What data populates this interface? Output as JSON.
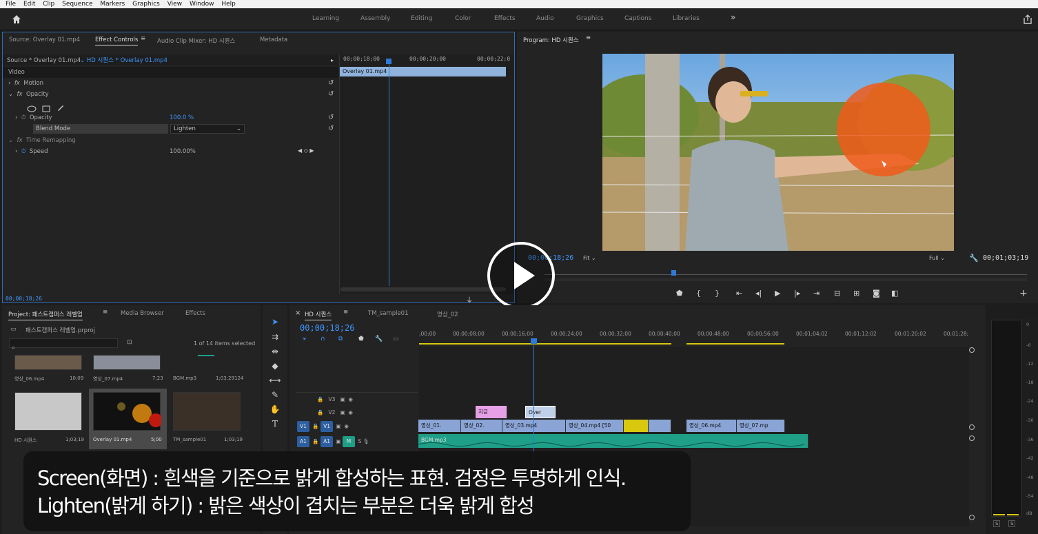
{
  "menu": [
    "File",
    "Edit",
    "Clip",
    "Sequence",
    "Markers",
    "Graphics",
    "View",
    "Window",
    "Help"
  ],
  "workspaces": [
    "Learning",
    "Assembly",
    "Editing",
    "Color",
    "Effects",
    "Audio",
    "Graphics",
    "Captions",
    "Libraries"
  ],
  "workspaces_more": "»",
  "effect_panel": {
    "tabs": [
      "Source: Overlay 01.mp4",
      "Effect Controls",
      "Audio Clip Mixer: HD 시퀀스",
      "Metadata"
    ],
    "source_label": "Source * Overlay 01.mp4",
    "sequence_label": "HD 시퀀스 * Overlay 01.mp4",
    "video_header": "Video",
    "motion": "Motion",
    "opacity": "Opacity",
    "opacity_prop": "Opacity",
    "opacity_value": "100.0 %",
    "blend_mode": "Blend Mode",
    "blend_value": "Lighten",
    "time_remapping": "Time Remapping",
    "speed": "Speed",
    "speed_value": "100.00%",
    "ruler": [
      "00;00;18;00",
      "00;00;20;00",
      "00;00;22;0"
    ],
    "clip_name": "Overlay 01.mp4",
    "timecode": "00;00;18;26"
  },
  "program": {
    "title": "Program: HD 시퀀스",
    "timecode": "00;00;18;26",
    "fit": "Fit",
    "quality": "Full",
    "duration": "00;01;03;19"
  },
  "project": {
    "tabs": [
      "Project: 패스트캠퍼스 레벨업",
      "Media Browser",
      "Effects"
    ],
    "file": "패스트캠퍼스 레벨업.prproj",
    "selected": "1 of 14 items selected",
    "items": [
      {
        "name": "영상_06.mp4",
        "dur": "10;09"
      },
      {
        "name": "영상_07.mp4",
        "dur": "7;23"
      },
      {
        "name": "BGM.mp3",
        "dur": "1;03;29124"
      },
      {
        "name": "HD 시퀀스",
        "dur": "1;03;19"
      },
      {
        "name": "Overlay 01.mp4",
        "dur": "5;00"
      },
      {
        "name": "TM_sample01",
        "dur": "1;03;19"
      }
    ]
  },
  "timeline": {
    "tabs": [
      "HD 시퀀스",
      "TM_sample01",
      "영상_02"
    ],
    "timecode": "00;00;18;26",
    "ruler": [
      ";00;00",
      "00;00;08;00",
      "00;00;16;00",
      "00;00;24;00",
      "00;00;32;00",
      "00;00;40;00",
      "00;00;48;00",
      "00;00;56;00",
      "00;01;04;02",
      "00;01;12;02",
      "00;01;20;02",
      "00;01;28;"
    ],
    "tracks": [
      "V3",
      "V2",
      "V1",
      "A1"
    ],
    "v2_clips": [
      "지금",
      "Over"
    ],
    "v1_clips": [
      "영상_01.",
      "영상_02.",
      "영상_03.mp4",
      "영상_04.mp4 [50",
      "영상_06.mp4",
      "영상_07.mp"
    ],
    "a1_clip": "BGM.mp3",
    "mute": "M",
    "solo": "S"
  },
  "meter": {
    "scale": [
      "0",
      "-6",
      "-12",
      "-18",
      "-24",
      "-30",
      "-36",
      "-42",
      "-48",
      "-54",
      "dB"
    ],
    "solo": [
      "S",
      "S"
    ]
  },
  "subtitle": {
    "line1": "Screen(화면) : 흰색을 기준으로 밝게 합성하는 표현. 검정은 투명하게 인식.",
    "line2": "Lighten(밝게 하기) : 밝은 색상이 겹치는 부분은 더욱 밝게 합성"
  },
  "colors": {
    "accent": "#3e97ff",
    "v1_clip": "#8aa4d6",
    "v2_clip": "#e6a0e6",
    "a1_clip": "#1f9f87",
    "yellow": "#d8c80e"
  }
}
